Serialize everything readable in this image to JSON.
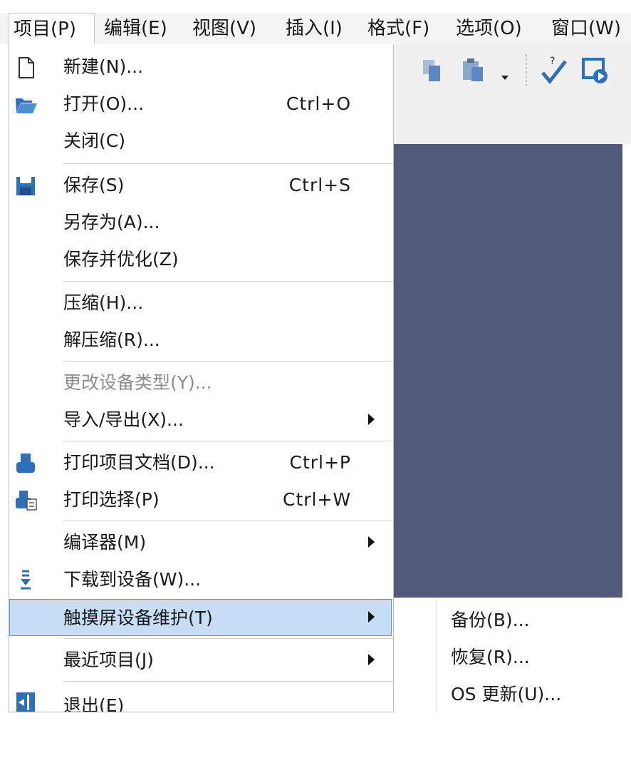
{
  "menubar": {
    "items": [
      "项目(P)",
      "编辑(E)",
      "视图(V)",
      "插入(I)",
      "格式(F)",
      "选项(O)",
      "窗口(W)"
    ]
  },
  "toolbar": {
    "icons": [
      "copy-icon",
      "paste-icon",
      "dropdown-arrow-icon",
      "help-check-icon",
      "run-simulation-icon"
    ]
  },
  "menu": {
    "items": [
      {
        "label": "新建(N)...",
        "shortcut": "",
        "icon": "new-file-icon",
        "submenu": false,
        "disabled": false
      },
      {
        "label": "打开(O)...",
        "shortcut": "Ctrl+O",
        "icon": "open-folder-icon",
        "submenu": false,
        "disabled": false
      },
      {
        "label": "关闭(C)",
        "shortcut": "",
        "icon": "",
        "submenu": false,
        "disabled": false
      },
      {
        "label": "保存(S)",
        "shortcut": "Ctrl+S",
        "icon": "save-icon",
        "submenu": false,
        "disabled": false
      },
      {
        "label": "另存为(A)...",
        "shortcut": "",
        "icon": "",
        "submenu": false,
        "disabled": false
      },
      {
        "label": "保存并优化(Z)",
        "shortcut": "",
        "icon": "",
        "submenu": false,
        "disabled": false
      },
      {
        "label": "压缩(H)...",
        "shortcut": "",
        "icon": "",
        "submenu": false,
        "disabled": false
      },
      {
        "label": "解压缩(R)...",
        "shortcut": "",
        "icon": "",
        "submenu": false,
        "disabled": false
      },
      {
        "label": "更改设备类型(Y)...",
        "shortcut": "",
        "icon": "",
        "submenu": false,
        "disabled": true
      },
      {
        "label": "导入/导出(X)...",
        "shortcut": "",
        "icon": "",
        "submenu": true,
        "disabled": false
      },
      {
        "label": "打印项目文档(D)...",
        "shortcut": "Ctrl+P",
        "icon": "print-icon",
        "submenu": false,
        "disabled": false
      },
      {
        "label": "打印选择(P)",
        "shortcut": "Ctrl+W",
        "icon": "print-selection-icon",
        "submenu": false,
        "disabled": false
      },
      {
        "label": "编译器(M)",
        "shortcut": "",
        "icon": "",
        "submenu": true,
        "disabled": false
      },
      {
        "label": "下载到设备(W)...",
        "shortcut": "",
        "icon": "download-icon",
        "submenu": false,
        "disabled": false
      },
      {
        "label": "触摸屏设备维护(T)",
        "shortcut": "",
        "icon": "",
        "submenu": true,
        "disabled": false,
        "highlighted": true
      },
      {
        "label": "最近项目(J)",
        "shortcut": "",
        "icon": "",
        "submenu": true,
        "disabled": false
      },
      {
        "label": "退出(E)",
        "shortcut": "",
        "icon": "exit-icon",
        "submenu": false,
        "disabled": false
      }
    ]
  },
  "submenu": {
    "items": [
      "备份(B)...",
      "恢复(R)...",
      "OS 更新(U)..."
    ]
  },
  "colors": {
    "workspace": "#525a7c",
    "highlight_bg": "#c8def6",
    "highlight_border": "#4d9ae0",
    "icon_blue": "#2f6fb8"
  }
}
